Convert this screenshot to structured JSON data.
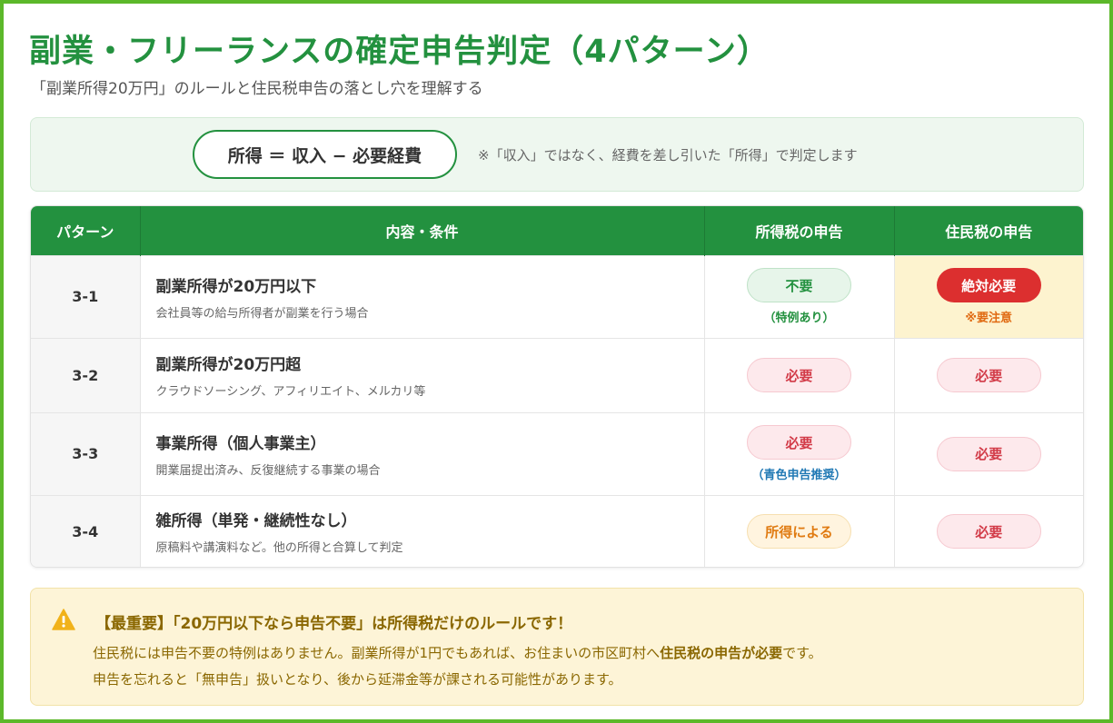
{
  "header": {
    "title": "副業・フリーランスの確定申告判定（4パターン）",
    "subtitle": "「副業所得20万円」のルールと住民税申告の落とし穴を理解する"
  },
  "formula": {
    "text": "所得 ＝ 収入 − 必要経費",
    "note": "※「収入」ではなく、経費を差し引いた「所得」で判定します"
  },
  "table": {
    "headers": [
      "パターン",
      "内容・条件",
      "所得税の申告",
      "住民税の申告"
    ],
    "rows": [
      {
        "id": "3-1",
        "title": "副業所得が20万円以下",
        "sub": "会社員等の給与所得者が副業を行う場合",
        "income_tax": "不要",
        "income_tax_note": "（特例あり）",
        "resident_tax": "絶対必要",
        "resident_tax_note": "※要注意"
      },
      {
        "id": "3-2",
        "title": "副業所得が20万円超",
        "sub": "クラウドソーシング、アフィリエイト、メルカリ等",
        "income_tax": "必要",
        "resident_tax": "必要"
      },
      {
        "id": "3-3",
        "title": "事業所得（個人事業主）",
        "sub": "開業届提出済み、反復継続する事業の場合",
        "income_tax": "必要",
        "income_tax_note": "（青色申告推奨）",
        "resident_tax": "必要"
      },
      {
        "id": "3-4",
        "title": "雑所得（単発・継続性なし）",
        "sub": "原稿料や講演料など。他の所得と合算して判定",
        "income_tax": "所得による",
        "resident_tax": "必要"
      }
    ]
  },
  "alert": {
    "title": "【最重要】「20万円以下なら申告不要」は所得税だけのルールです！",
    "line1_pre": "住民税には申告不要の特例はありません。副業所得が1円でもあれば、お住まいの市区町村へ",
    "line1_bold": "住民税の申告が必要",
    "line1_post": "です。",
    "line2": "申告を忘れると「無申告」扱いとなり、後から延滞金等が課される可能性があります。"
  },
  "colors": {
    "brand_green": "#23913f",
    "frame_green": "#5cb82a",
    "danger_red": "#dc2f2f",
    "warning_bg": "#fdf4d7"
  },
  "icons": {
    "alert": "warning-triangle-icon"
  }
}
